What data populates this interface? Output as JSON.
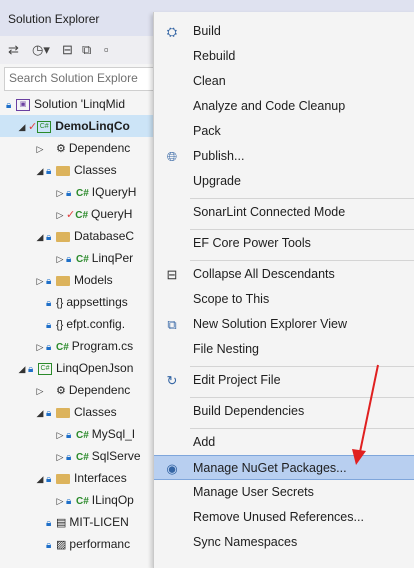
{
  "solution_explorer": {
    "title": "Solution Explorer",
    "search_placeholder": "Search Solution Explore",
    "tree": [
      {
        "label": "Solution 'LinqMid",
        "kind": "solution"
      },
      {
        "label": "DemoLinqCo",
        "kind": "project",
        "bold": true,
        "selected": true
      },
      {
        "label": "Dependenc",
        "kind": "deps"
      },
      {
        "label": "Classes",
        "kind": "folder"
      },
      {
        "label": "IQueryH",
        "kind": "cs"
      },
      {
        "label": "QueryH",
        "kind": "cs-check"
      },
      {
        "label": "DatabaseC",
        "kind": "folder"
      },
      {
        "label": "LinqPer",
        "kind": "cs"
      },
      {
        "label": "Models",
        "kind": "folder"
      },
      {
        "label": "appsettings",
        "kind": "json"
      },
      {
        "label": "efpt.config.",
        "kind": "json"
      },
      {
        "label": "Program.cs",
        "kind": "cs"
      },
      {
        "label": "LinqOpenJson",
        "kind": "project"
      },
      {
        "label": "Dependenc",
        "kind": "deps"
      },
      {
        "label": "Classes",
        "kind": "folder"
      },
      {
        "label": "MySql_I",
        "kind": "cs"
      },
      {
        "label": "SqlServe",
        "kind": "cs"
      },
      {
        "label": "Interfaces",
        "kind": "folder"
      },
      {
        "label": "ILinqOp",
        "kind": "cs"
      },
      {
        "label": "MIT-LICEN",
        "kind": "file"
      },
      {
        "label": "performanc",
        "kind": "file"
      }
    ]
  },
  "context_menu": {
    "items": [
      {
        "label": "Build",
        "icon": "build-icon"
      },
      {
        "label": "Rebuild"
      },
      {
        "label": "Clean"
      },
      {
        "label": "Analyze and Code Cleanup"
      },
      {
        "label": "Pack"
      },
      {
        "label": "Publish...",
        "icon": "globe-icon"
      },
      {
        "label": "Upgrade"
      },
      {
        "label": "SonarLint Connected Mode"
      },
      {
        "label": "EF Core Power Tools"
      },
      {
        "label": "Collapse All Descendants",
        "icon": "collapse-icon"
      },
      {
        "label": "Scope to This"
      },
      {
        "label": "New Solution Explorer View",
        "icon": "new-view-icon"
      },
      {
        "label": "File Nesting"
      },
      {
        "label": "Edit Project File",
        "icon": "edit-arrow-icon"
      },
      {
        "label": "Build Dependencies"
      },
      {
        "label": "Add"
      },
      {
        "label": "Manage NuGet Packages...",
        "icon": "nuget-icon",
        "highlighted": true
      },
      {
        "label": "Manage User Secrets"
      },
      {
        "label": "Remove Unused References..."
      },
      {
        "label": "Sync Namespaces"
      }
    ]
  },
  "annotation_color": "#e02020"
}
